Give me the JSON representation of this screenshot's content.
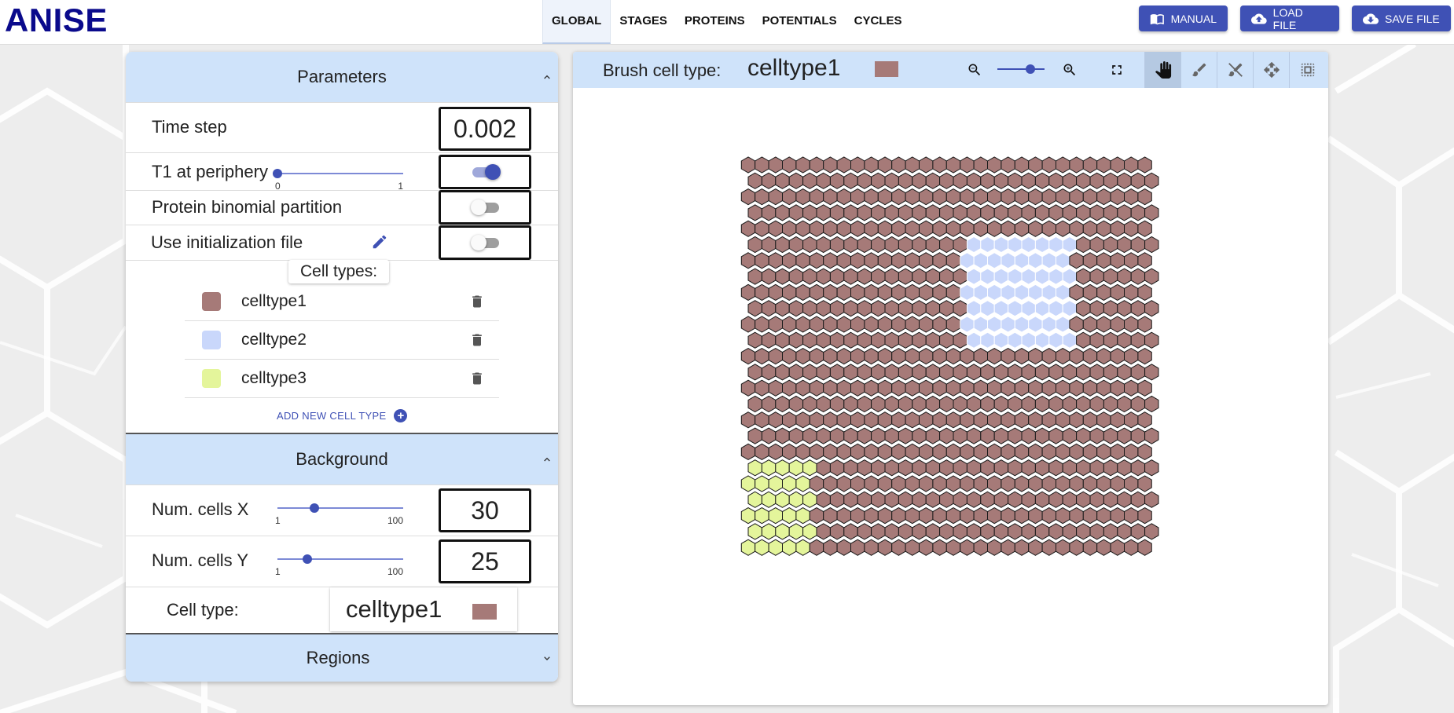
{
  "app": {
    "title": "ANISE"
  },
  "nav": {
    "tabs": [
      {
        "label": "GLOBAL",
        "active": true
      },
      {
        "label": "STAGES",
        "active": false
      },
      {
        "label": "PROTEINS",
        "active": false
      },
      {
        "label": "POTENTIALS",
        "active": false
      },
      {
        "label": "CYCLES",
        "active": false
      }
    ],
    "buttons": {
      "manual": {
        "label": "MANUAL",
        "icon": "book-icon"
      },
      "load": {
        "label": "LOAD FILE",
        "icon": "cloud-upload-icon"
      },
      "save": {
        "label": "SAVE FILE",
        "icon": "cloud-download-icon"
      }
    }
  },
  "colors": {
    "accent": "#3f51b5",
    "section_header": "#cfe3fa",
    "celltype1": "#a67a78",
    "celltype2": "#c9d7fb",
    "celltype3": "#e4f59b"
  },
  "parameters": {
    "title": "Parameters",
    "time_step": {
      "label": "Time step",
      "value": "0.002",
      "slider_min": "0",
      "slider_max": "1",
      "slider_fraction": 0.002
    },
    "t1_periphery": {
      "label": "T1 at periphery",
      "on": true
    },
    "protein_binomial": {
      "label": "Protein binomial partition",
      "on": false
    },
    "use_init_file": {
      "label": "Use initialization file",
      "on": false,
      "icon": "pencil-icon"
    },
    "cell_types_label": "Cell types:",
    "cell_types": [
      {
        "name": "celltype1",
        "color": "#a67a78"
      },
      {
        "name": "celltype2",
        "color": "#c9d7fb"
      },
      {
        "name": "celltype3",
        "color": "#e4f59b"
      }
    ],
    "add_cell_type": "ADD NEW CELL TYPE"
  },
  "background": {
    "title": "Background",
    "num_cells_x": {
      "label": "Num. cells X",
      "value": "30",
      "slider_min": "1",
      "slider_max": "100"
    },
    "num_cells_y": {
      "label": "Num. cells Y",
      "value": "25",
      "slider_min": "1",
      "slider_max": "100"
    },
    "cell_type": {
      "label": "Cell type:",
      "value": "celltype1",
      "color": "#a67a78"
    }
  },
  "regions": {
    "title": "Regions"
  },
  "canvas": {
    "brush_label": "Brush cell type:",
    "brush_value": "celltype1",
    "brush_color": "#a67a78",
    "zoom_level": 0.6,
    "tools": [
      "hand-icon",
      "brush-icon",
      "eraser-icon",
      "move-icon",
      "select-icon"
    ],
    "active_tool": "hand-icon",
    "grid": {
      "cols": 30,
      "rows": 25,
      "default_type": 0,
      "regions": [
        {
          "type": 1,
          "cols": [
            16,
            23
          ],
          "rows": [
            5,
            11
          ]
        },
        {
          "type": 2,
          "cols": [
            0,
            4
          ],
          "rows": [
            19,
            24
          ]
        }
      ]
    }
  }
}
